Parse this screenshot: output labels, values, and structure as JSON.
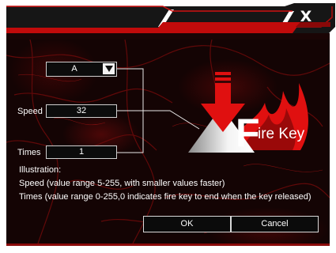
{
  "window": {
    "close_label": "X"
  },
  "controls": {
    "key_select": {
      "value": "A"
    },
    "speed": {
      "label": "Speed",
      "value": "32"
    },
    "times": {
      "label": "Times",
      "value": "1"
    }
  },
  "logo": {
    "big_letter": "F",
    "text": "ire Key"
  },
  "illustration": {
    "heading": "Illustration:",
    "line_speed": "Speed (value range 5-255, with smaller values faster)",
    "line_times": "Times (value range 0-255,0 indicates fire key to end when the key released)"
  },
  "buttons": {
    "ok": "OK",
    "cancel": "Cancel"
  },
  "colors": {
    "accent_red": "#e01010",
    "dark_bg": "#140404",
    "title_bar": "#1a1a1a"
  },
  "icons": {
    "close": "close-icon",
    "dropdown": "chevron-down-icon",
    "logo": "fire-key-logo"
  }
}
